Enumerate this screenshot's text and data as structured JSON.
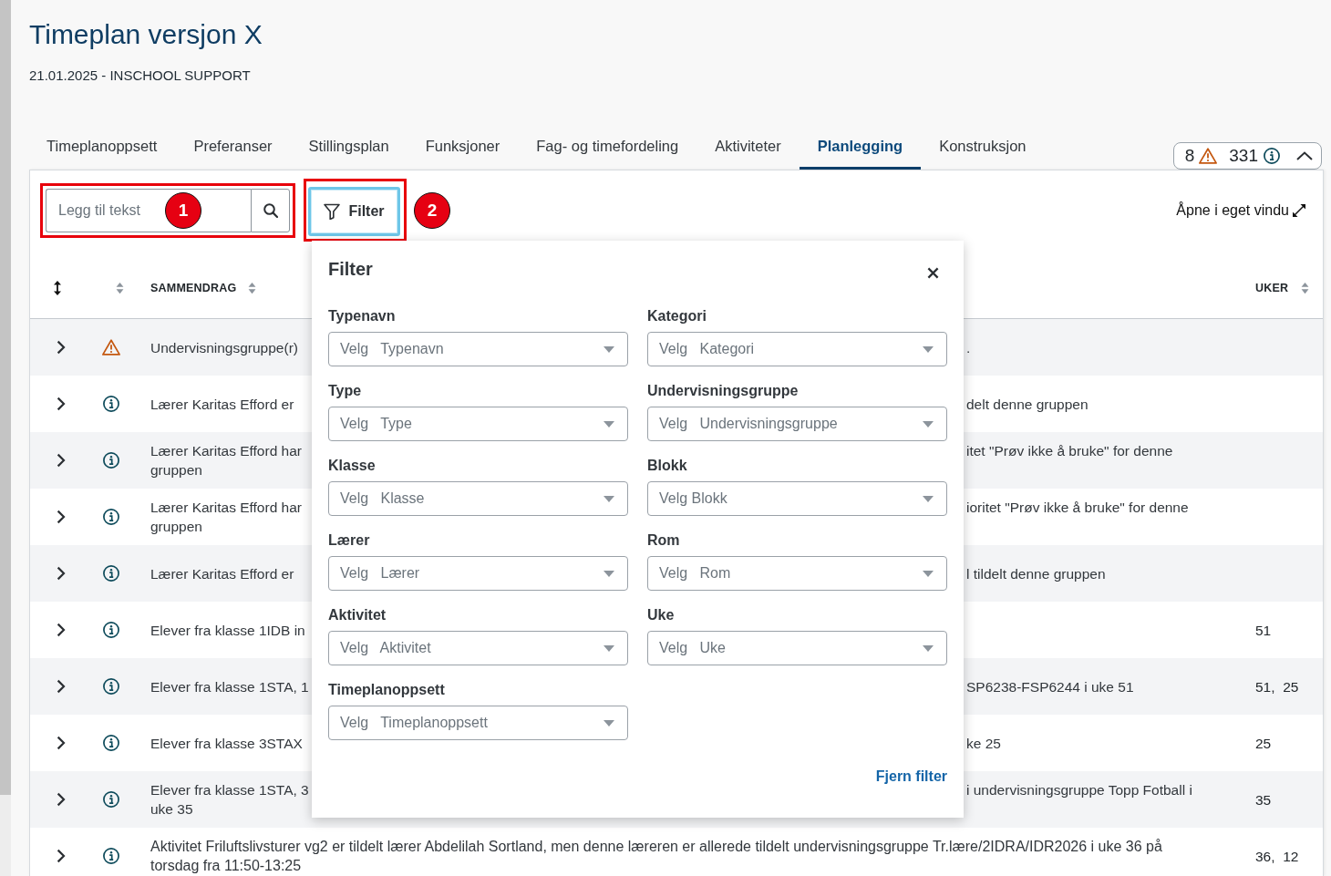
{
  "page": {
    "title": "Timeplan versjon X",
    "subtitle": "21.01.2025 - INSCHOOL SUPPORT"
  },
  "tabs": [
    {
      "label": "Timeplanoppsett",
      "selected": false
    },
    {
      "label": "Preferanser",
      "selected": false
    },
    {
      "label": "Stillingsplan",
      "selected": false
    },
    {
      "label": "Funksjoner",
      "selected": false
    },
    {
      "label": "Fag- og timefordeling",
      "selected": false
    },
    {
      "label": "Aktiviteter",
      "selected": false
    },
    {
      "label": "Planlegging",
      "selected": true
    },
    {
      "label": "Konstruksjon",
      "selected": false
    }
  ],
  "issue_summary": {
    "warnings": "8",
    "infos": "331",
    "expanded": true
  },
  "toolbar": {
    "search": {
      "placeholder": "Legg til tekst"
    },
    "filter_button": {
      "label": "Filter",
      "focused": true
    },
    "open_window_link": "Åpne i eget vindu"
  },
  "annotations": [
    {
      "label": "1"
    },
    {
      "label": "2"
    }
  ],
  "table": {
    "columns": [
      {
        "label": "SAMMENDRAG"
      },
      {
        "label": "UKER"
      }
    ],
    "rows": [
      {
        "kind": "warning",
        "expanded": false,
        "summary_left": [
          "Undervisningsgruppe(r)"
        ],
        "summary_right": [
          "."
        ]
      },
      {
        "kind": "info",
        "expanded": false,
        "summary_left": [
          "Lærer Karitas Efford er"
        ],
        "summary_right": [
          "delt denne gruppen"
        ]
      },
      {
        "kind": "info",
        "expanded": false,
        "summary_left": [
          "Lærer Karitas Efford har",
          "gruppen"
        ],
        "summary_right": [
          "itet \"Prøv ikke å bruke\" for denne"
        ]
      },
      {
        "kind": "info",
        "expanded": false,
        "summary_left": [
          "Lærer Karitas Efford har",
          "gruppen"
        ],
        "summary_right": [
          "ioritet \"Prøv ikke å bruke\" for denne"
        ]
      },
      {
        "kind": "info",
        "expanded": false,
        "summary_left": [
          "Lærer Karitas Efford er"
        ],
        "summary_right": [
          "l tildelt denne gruppen"
        ]
      },
      {
        "kind": "info",
        "expanded": false,
        "summary_left": [
          "Elever fra klasse 1IDB in"
        ],
        "weeks": "51"
      },
      {
        "kind": "info",
        "expanded": false,
        "summary_left": [
          "Elever fra klasse 1STA, 1"
        ],
        "summary_right": [
          "SP6238-FSP6244 i uke 51"
        ],
        "weeks": "51,  25"
      },
      {
        "kind": "info",
        "expanded": false,
        "summary_left": [
          "Elever fra klasse 3STAX"
        ],
        "summary_right": [
          "ke 25"
        ],
        "weeks": "25"
      },
      {
        "kind": "info",
        "expanded": false,
        "summary_left": [
          "Elever fra klasse 1STA, 3",
          "uke 35"
        ],
        "summary_right": [
          "i undervisningsgruppe Topp Fotball i"
        ],
        "weeks": "35"
      },
      {
        "kind": "info",
        "expanded": false,
        "summary": "Aktivitet Friluftslivsturer vg2 er tildelt lærer Abdelilah Sortland, men denne læreren er allerede tildelt undervisningsgruppe Tr.lære/2IDRA/IDR2026 i uke 36 på torsdag fra 11:50-13:25",
        "weeks": "36,  12"
      }
    ]
  },
  "filter_panel": {
    "title": "Filter",
    "fields": [
      {
        "label": "Typenavn",
        "placeholder": "Velg   Typenavn"
      },
      {
        "label": "Kategori",
        "placeholder": "Velg   Kategori"
      },
      {
        "label": "Type",
        "placeholder": "Velg   Type"
      },
      {
        "label": "Undervisningsgruppe",
        "placeholder": "Velg   Undervisningsgruppe"
      },
      {
        "label": "Klasse",
        "placeholder": "Velg   Klasse"
      },
      {
        "label": "Blokk",
        "placeholder": "Velg Blokk"
      },
      {
        "label": "Lærer",
        "placeholder": "Velg   Lærer"
      },
      {
        "label": "Rom",
        "placeholder": "Velg   Rom"
      },
      {
        "label": "Aktivitet",
        "placeholder": "Velg   Aktivitet"
      },
      {
        "label": "Uke",
        "placeholder": "Velg   Uke"
      },
      {
        "label": "Timeplanoppsett",
        "placeholder": "Velg   Timeplanoppsett"
      }
    ],
    "clear_link": "Fjern filter"
  }
}
